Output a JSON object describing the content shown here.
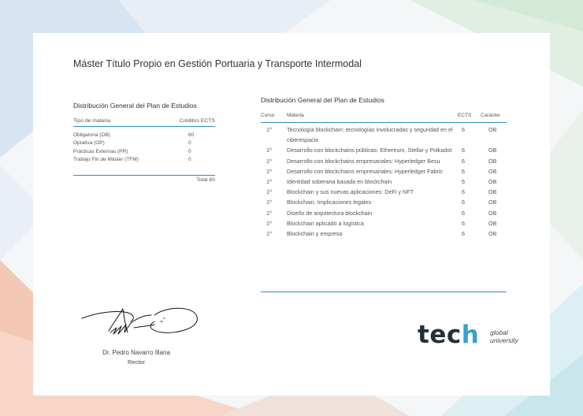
{
  "header": {
    "title": "Máster Título Propio en Gestión Portuaria y Transporte Intermodal"
  },
  "summary": {
    "heading": "Distribución General del Plan de Estudios",
    "col_type": "Tipo de materia",
    "col_credits": "Créditos ECTS",
    "rows": [
      {
        "label": "Obligatoria (OB)",
        "value": "60"
      },
      {
        "label": "Optativa (OP)",
        "value": "0"
      },
      {
        "label": "Prácticas Externas (PR)",
        "value": "0"
      },
      {
        "label": "Trabajo Fin de Máster (TFM)",
        "value": "0"
      }
    ],
    "total": "Total 60"
  },
  "courses": {
    "heading": "Distribución General del Plan de Estudios",
    "col_course": "Curso",
    "col_subject": "Materia",
    "col_ects": "ECTS",
    "col_character": "Carácter",
    "rows": [
      {
        "course": "1º",
        "subject": "Tecnología blockchain: tecnologías involucradas y seguridad en el ciberespacio",
        "ects": "6",
        "character": "OB"
      },
      {
        "course": "1º",
        "subject": "Desarrollo con blockchains públicas: Ethereum, Stellar y Polkadot",
        "ects": "6",
        "character": "OB"
      },
      {
        "course": "1º",
        "subject": "Desarrollo con blockchains empresariales: Hyperledger Besu",
        "ects": "6",
        "character": "OB"
      },
      {
        "course": "1º",
        "subject": "Desarrollo con blockchains empresariales: Hyperledger Fabric",
        "ects": "6",
        "character": "OB"
      },
      {
        "course": "1º",
        "subject": "Identidad soberana basada en blockchain",
        "ects": "6",
        "character": "OB"
      },
      {
        "course": "1º",
        "subject": "Blockchain y sus nuevas aplicaciones: DeFi y NFT",
        "ects": "6",
        "character": "OB"
      },
      {
        "course": "1º",
        "subject": "Blockchain. Implicaciones legales",
        "ects": "6",
        "character": "OB"
      },
      {
        "course": "1º",
        "subject": "Diseño de arquitectura blockchain",
        "ects": "6",
        "character": "OB"
      },
      {
        "course": "1º",
        "subject": "Blockchain aplicado a logística",
        "ects": "6",
        "character": "OB"
      },
      {
        "course": "1º",
        "subject": "Blockchain y empresa",
        "ects": "6",
        "character": "OB"
      }
    ]
  },
  "signatory": {
    "name": "Dr. Pedro Navarro Illana",
    "role": "Rector"
  },
  "logo": {
    "word_part1": "tec",
    "word_part2": "h",
    "line1": "global",
    "line2": "university"
  },
  "colors": {
    "accent": "#2e8fbf",
    "logo_dark": "#22303a",
    "logo_accent": "#34a3c7"
  }
}
